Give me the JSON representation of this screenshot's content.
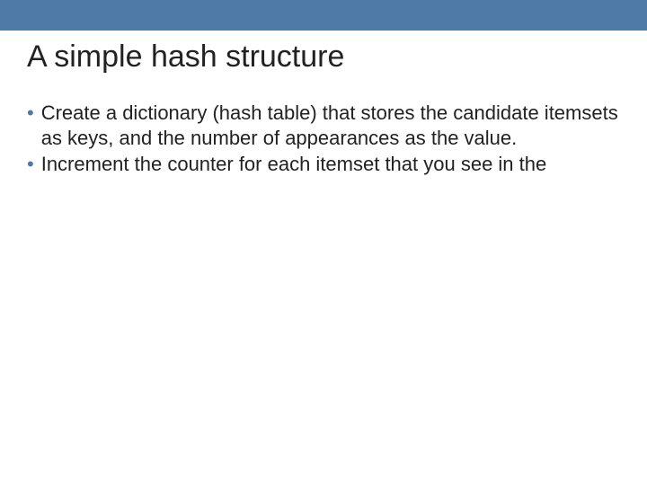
{
  "slide": {
    "title": "A simple hash structure",
    "bullets": [
      "Create a dictionary (hash table) that stores the candidate itemsets as keys, and the number of appearances as the value.",
      "Increment the counter for each itemset that you see in the"
    ]
  },
  "colors": {
    "accent": "#4f79a6",
    "text": "#222222"
  }
}
